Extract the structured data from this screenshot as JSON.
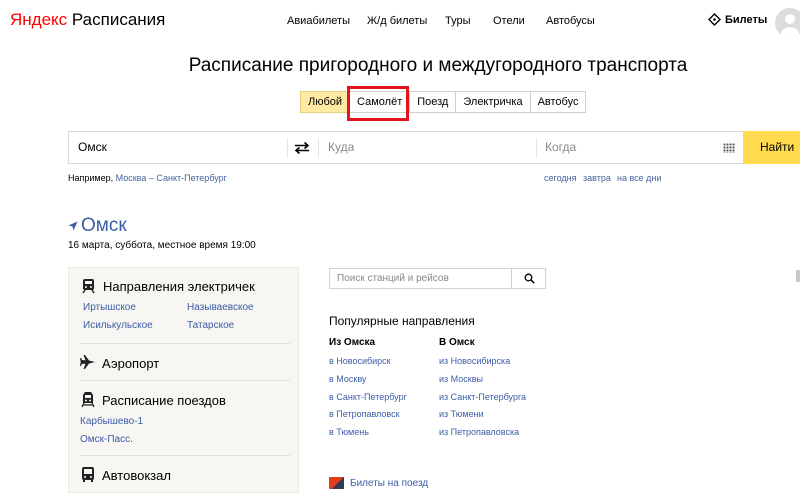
{
  "header": {
    "logo_part1": "Яндекс",
    "logo_part2": "Расписания",
    "nav": [
      "Авиабилеты",
      "Ж/д билеты",
      "Туры",
      "Отели",
      "Автобусы"
    ],
    "tickets_label": "Билеты",
    "tickets_icon": "ticket-icon"
  },
  "title": "Расписание пригородного и междугородного транспорта",
  "transport_tabs": {
    "items": [
      "Любой",
      "Самолёт",
      "Поезд",
      "Электричка",
      "Автобус"
    ],
    "selected": "Любой",
    "highlight_color": "#e3141d",
    "selected_color": "#ffe9a3"
  },
  "search": {
    "from_value": "Омск",
    "to_placeholder": "Куда",
    "when_placeholder": "Когда",
    "swap_icon": "swap-arrows-icon",
    "calendar_icon": "calendar-icon",
    "find_label": "Найти",
    "find_color": "#ffdb4d"
  },
  "hints": {
    "example_prefix": "Например,",
    "example_link": "Москва – Санкт-Петербург",
    "dates": [
      "сегодня",
      "завтра",
      "на все дни"
    ]
  },
  "city": {
    "name": "Омск",
    "date": "16 марта, суббота, местное время 19:00",
    "link_color": "#3c5ca8"
  },
  "panel": {
    "suburban": {
      "title": "Направления электричек",
      "icon": "suburban-train-icon",
      "links": [
        "Иртышское",
        "Называевское",
        "Исилькульское",
        "Татарское"
      ]
    },
    "airport": {
      "title": "Аэропорт",
      "icon": "airplane-icon"
    },
    "trains": {
      "title": "Расписание поездов",
      "icon": "train-icon",
      "links": [
        "Карбышево-1",
        "Омск-Пасс."
      ]
    },
    "bus": {
      "title": "Автовокзал",
      "icon": "bus-icon"
    }
  },
  "station_search": {
    "placeholder": "Поиск станций и рейсов",
    "icon": "search-icon"
  },
  "popular": {
    "title": "Популярные направления",
    "from_title": "Из Омска",
    "to_title": "В Омск",
    "from": [
      "в Новосибирск",
      "в Москву",
      "в Санкт-Петербург",
      "в Петропавловск",
      "в Тюмень"
    ],
    "to": [
      "из Новосибирска",
      "из Москвы",
      "из Санкт-Петербурга",
      "из Тюмени",
      "из Петропавловска"
    ]
  },
  "train_tickets_link": "Билеты на поезд"
}
